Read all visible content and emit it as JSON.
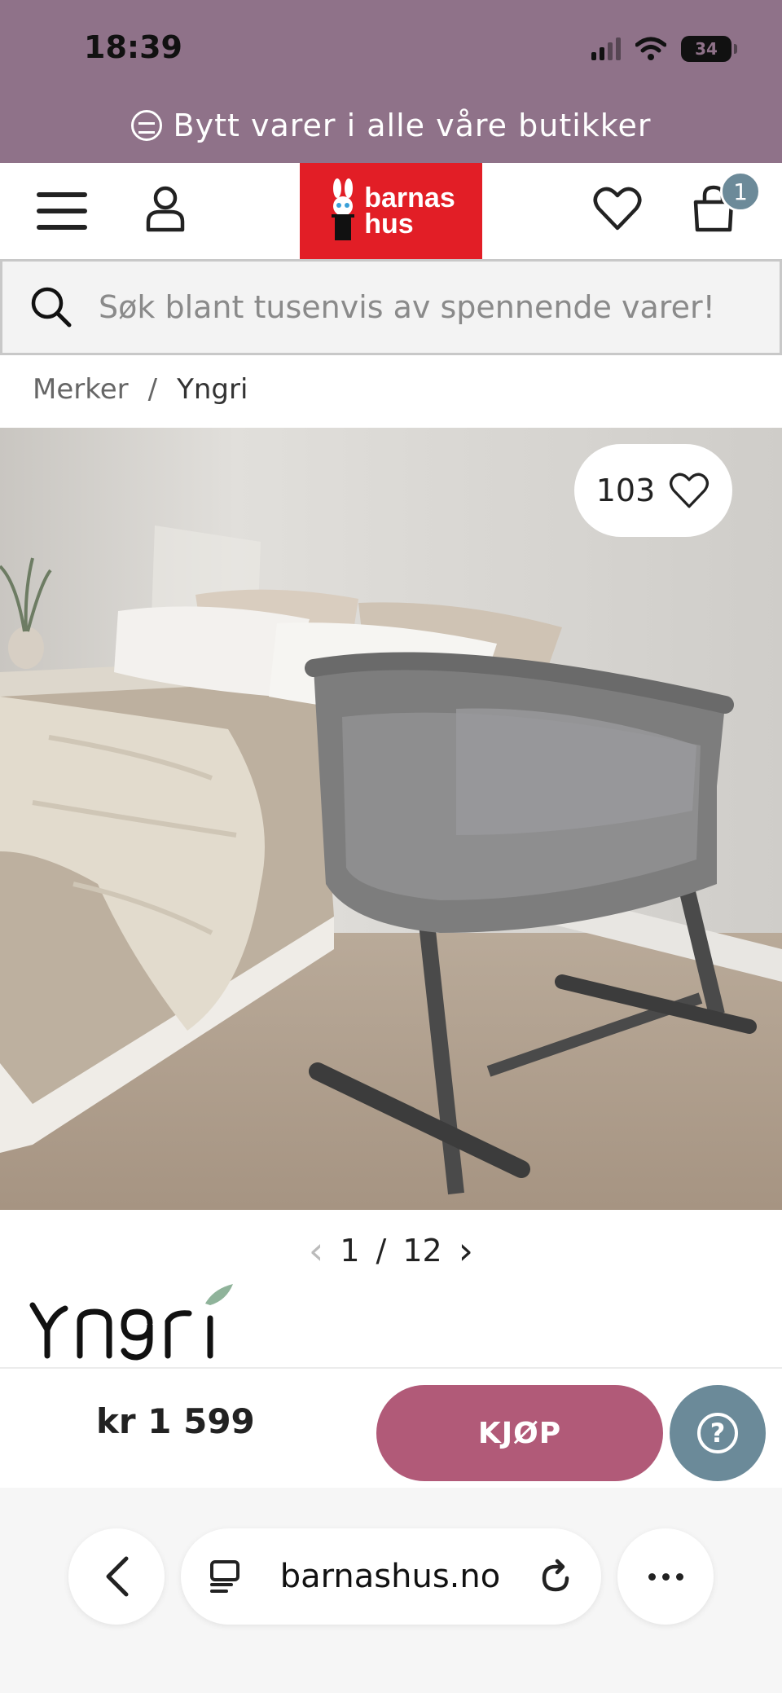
{
  "status_bar": {
    "time": "18:39",
    "battery": "34"
  },
  "promo": {
    "text": "Bytt varer i alle våre butikker"
  },
  "header": {
    "logo_line1": "barnas",
    "logo_line2": "hus",
    "cart_count": "1"
  },
  "search": {
    "placeholder": "Søk blant tusenvis av spennende varer!"
  },
  "breadcrumb": {
    "items": [
      "Merker",
      "Yngri"
    ],
    "separator": "/"
  },
  "product": {
    "wishlist_count": "103",
    "image_index": "1",
    "image_total": "12",
    "brand_logo": "Yngri",
    "price": "kr 1 599",
    "buy_label": "KJØP"
  },
  "browser": {
    "url": "barnashus.no"
  },
  "colors": {
    "status_band": "#8f7289",
    "logo_red": "#e21e26",
    "buy_button": "#b15a78",
    "help_button": "#6b8a99"
  },
  "icons": [
    "promo-exchange-icon",
    "menu-icon",
    "user-icon",
    "heart-icon",
    "bag-icon",
    "search-icon",
    "chevron-left-icon",
    "chevron-right-icon",
    "help-icon",
    "tabs-icon",
    "reload-icon",
    "more-icon"
  ]
}
